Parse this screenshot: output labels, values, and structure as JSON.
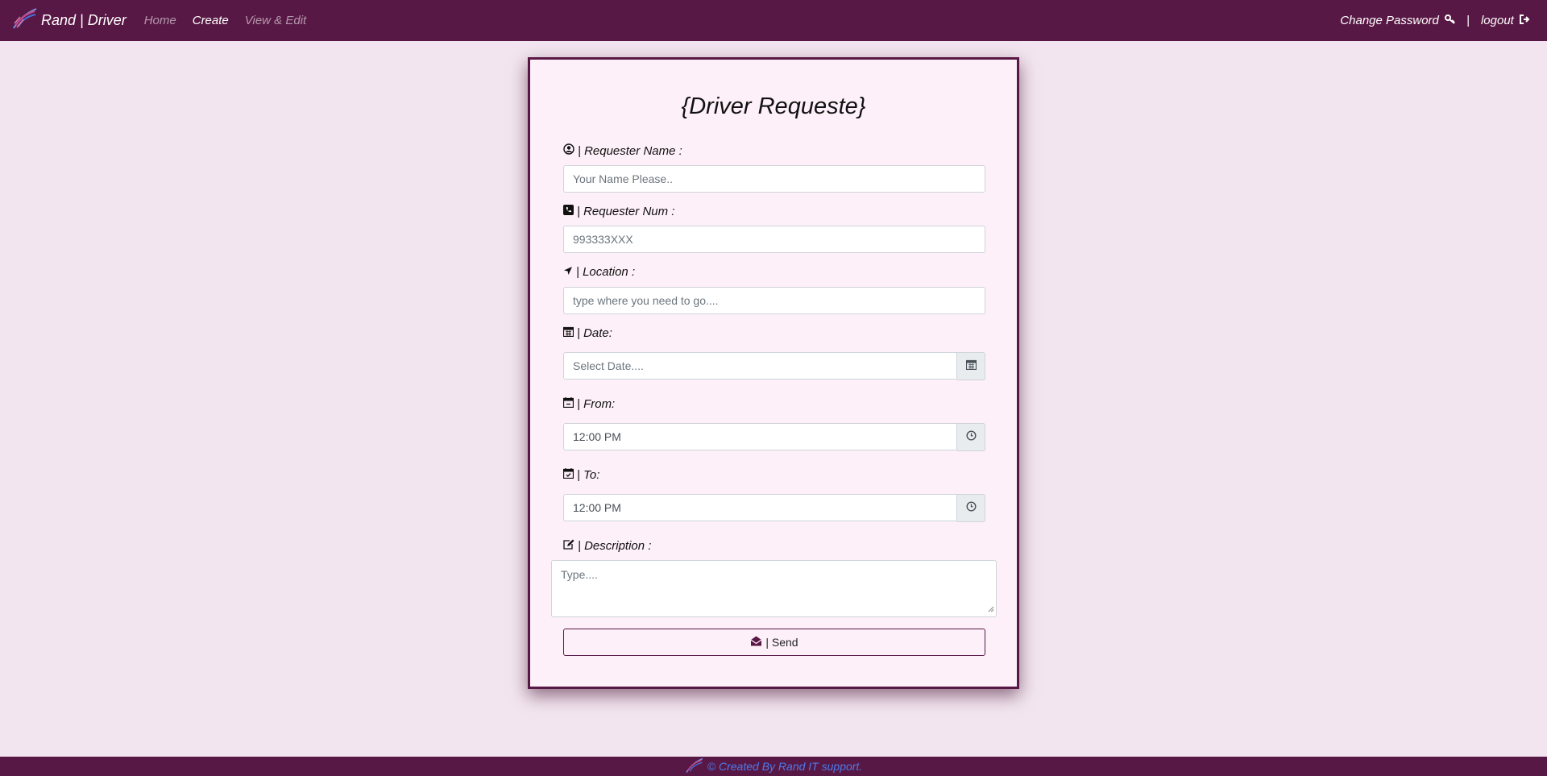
{
  "navbar": {
    "brand": "Rand | Driver",
    "links": [
      {
        "label": "Home",
        "active": false
      },
      {
        "label": "Create",
        "active": true
      },
      {
        "label": "View & Edit",
        "active": false
      }
    ],
    "change_password": "Change Password",
    "separator": "|",
    "logout": "logout"
  },
  "form": {
    "title": "{Driver Requeste}",
    "requester_name": {
      "label": "| Requester Name :",
      "placeholder": "Your Name Please.."
    },
    "requester_num": {
      "label": "| Requester Num :",
      "placeholder": "993333XXX"
    },
    "location": {
      "label": "| Location :",
      "placeholder": "type where you need to go...."
    },
    "date": {
      "label": "| Date:",
      "placeholder": "Select Date...."
    },
    "from": {
      "label": "| From:",
      "value": "12:00 PM"
    },
    "to": {
      "label": "| To:",
      "value": "12:00 PM"
    },
    "description": {
      "label": "| Description :",
      "placeholder": "Type...."
    },
    "send_label": "| Send"
  },
  "footer": {
    "text": "© Created By Rand IT support."
  },
  "colors": {
    "primary": "#581845",
    "background": "#f2e5ef",
    "card": "#fdf0f8",
    "footer_text": "#4b7bec"
  }
}
